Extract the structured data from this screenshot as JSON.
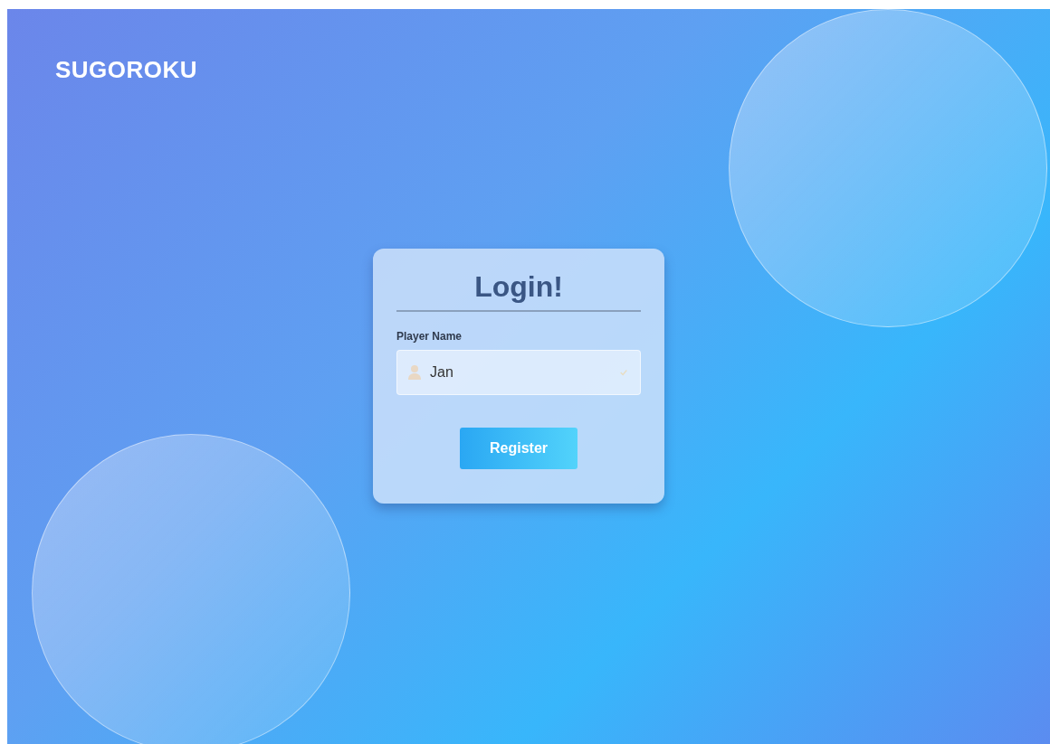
{
  "brand": {
    "title": "SUGOROKU"
  },
  "login": {
    "title": "Login!",
    "field": {
      "label": "Player Name",
      "value": "Jan"
    },
    "button": "Register"
  }
}
